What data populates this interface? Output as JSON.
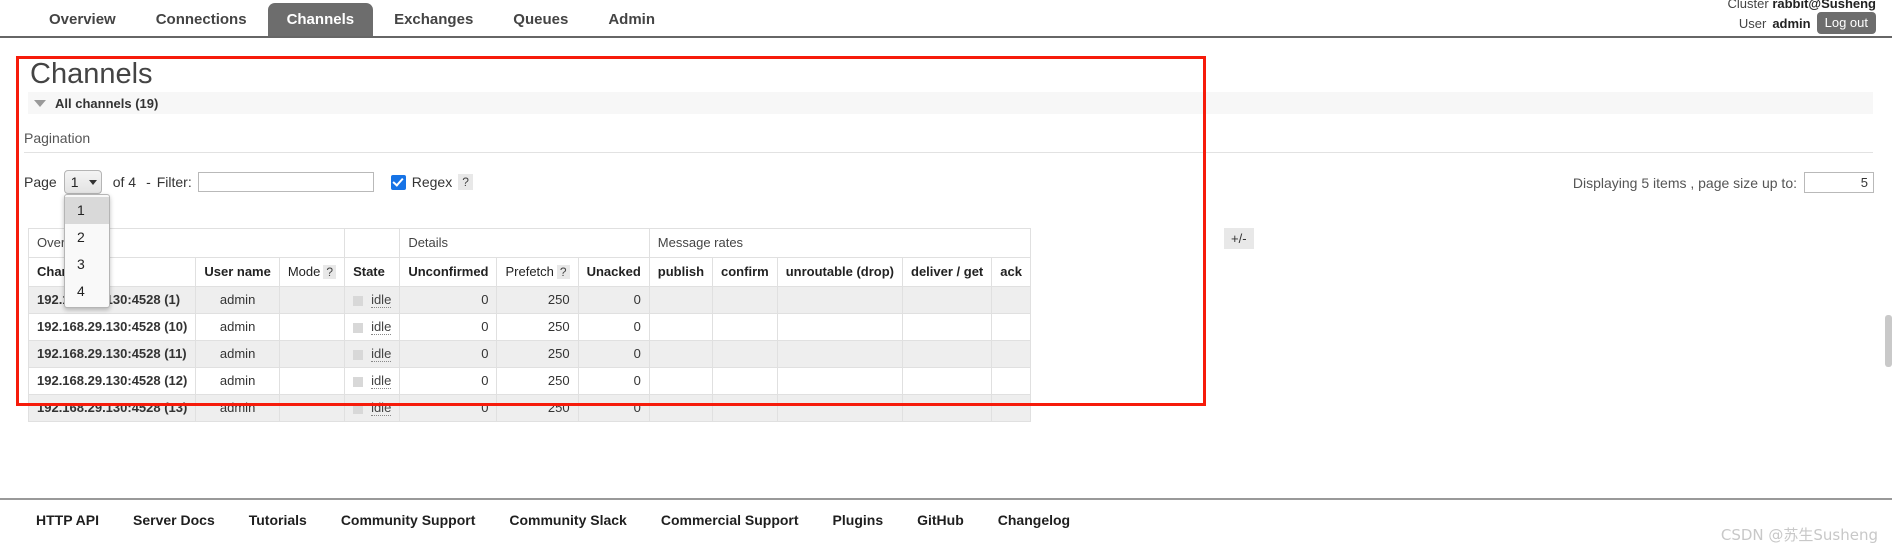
{
  "nav": {
    "tabs": [
      {
        "label": "Overview",
        "active": false
      },
      {
        "label": "Connections",
        "active": false
      },
      {
        "label": "Channels",
        "active": true
      },
      {
        "label": "Exchanges",
        "active": false
      },
      {
        "label": "Queues",
        "active": false
      },
      {
        "label": "Admin",
        "active": false
      }
    ]
  },
  "header": {
    "cluster_label": "Cluster",
    "cluster_name": "rabbit@Susheng",
    "user_label": "User",
    "user_name": "admin",
    "logout_label": "Log out"
  },
  "page": {
    "title": "Channels",
    "section_title": "All channels (19)"
  },
  "pagination": {
    "section_label": "Pagination",
    "page_label": "Page",
    "current_page": "1",
    "of_label": "of 4",
    "dash": "-",
    "filter_label": "Filter:",
    "filter_value": "",
    "filter_placeholder": "",
    "regex_label": "Regex",
    "regex_help": "?",
    "regex_checked": true,
    "dropdown_open": true,
    "dropdown_options": [
      "1",
      "2",
      "3",
      "4"
    ],
    "dropdown_selected": "1",
    "displaying_text": "Displaying 5 items , page size up to:",
    "page_size_value": "5"
  },
  "table": {
    "group_headers": [
      {
        "label": "Overview",
        "colspan": 3
      },
      {
        "label": "",
        "colspan": 1
      },
      {
        "label": "Details",
        "colspan": 3
      },
      {
        "label": "Message rates",
        "colspan": 5
      }
    ],
    "columns": [
      "Channel",
      "User name",
      "Mode",
      "State",
      "Unconfirmed",
      "Prefetch",
      "Unacked",
      "publish",
      "confirm",
      "unroutable (drop)",
      "deliver / get",
      "ack"
    ],
    "mode_help": "?",
    "prefetch_help": "?",
    "plus_minus": "+/-",
    "rows": [
      {
        "channel": "192.168.29.130:4528 (1)",
        "user_name": "admin",
        "mode": "",
        "state": "idle",
        "unconfirmed": "0",
        "prefetch": "250",
        "unacked": "0",
        "publish": "",
        "confirm": "",
        "unroutable": "",
        "deliver_get": "",
        "ack": ""
      },
      {
        "channel": "192.168.29.130:4528 (10)",
        "user_name": "admin",
        "mode": "",
        "state": "idle",
        "unconfirmed": "0",
        "prefetch": "250",
        "unacked": "0",
        "publish": "",
        "confirm": "",
        "unroutable": "",
        "deliver_get": "",
        "ack": ""
      },
      {
        "channel": "192.168.29.130:4528 (11)",
        "user_name": "admin",
        "mode": "",
        "state": "idle",
        "unconfirmed": "0",
        "prefetch": "250",
        "unacked": "0",
        "publish": "",
        "confirm": "",
        "unroutable": "",
        "deliver_get": "",
        "ack": ""
      },
      {
        "channel": "192.168.29.130:4528 (12)",
        "user_name": "admin",
        "mode": "",
        "state": "idle",
        "unconfirmed": "0",
        "prefetch": "250",
        "unacked": "0",
        "publish": "",
        "confirm": "",
        "unroutable": "",
        "deliver_get": "",
        "ack": ""
      },
      {
        "channel": "192.168.29.130:4528 (13)",
        "user_name": "admin",
        "mode": "",
        "state": "idle",
        "unconfirmed": "0",
        "prefetch": "250",
        "unacked": "0",
        "publish": "",
        "confirm": "",
        "unroutable": "",
        "deliver_get": "",
        "ack": ""
      }
    ]
  },
  "footer": {
    "links": [
      "HTTP API",
      "Server Docs",
      "Tutorials",
      "Community Support",
      "Community Slack",
      "Commercial Support",
      "Plugins",
      "GitHub",
      "Changelog"
    ]
  },
  "watermark": {
    "text": "CSDN @苏生Susheng"
  },
  "colors": {
    "accent_red": "#f61b0a",
    "nav_active": "#6d6d6d",
    "checkbox_blue": "#1673e6"
  }
}
